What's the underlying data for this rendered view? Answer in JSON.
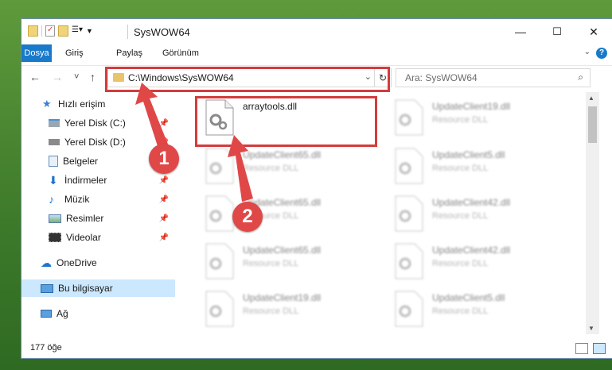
{
  "window": {
    "title": "SysWOW64",
    "controls": {
      "minimize": "—",
      "maximize": "☐",
      "close": "✕"
    }
  },
  "ribbon": {
    "tabs": [
      "Dosya",
      "Giriş",
      "Paylaş",
      "Görünüm"
    ],
    "help": "?"
  },
  "nav": {
    "back": "←",
    "forward": "→",
    "recent": "˅",
    "up": "↑",
    "address": "C:\\Windows\\SysWOW64",
    "search_placeholder": "Ara: SysWOW64"
  },
  "sidebar": {
    "items": [
      {
        "label": "Hızlı erişim",
        "icon": "star-icon",
        "pinned": false
      },
      {
        "label": "Yerel Disk (C:)",
        "icon": "drive-icon",
        "pinned": true
      },
      {
        "label": "Yerel Disk (D:)",
        "icon": "drive-icon",
        "pinned": true
      },
      {
        "label": "Belgeler",
        "icon": "document-icon",
        "pinned": true
      },
      {
        "label": "İndirmeler",
        "icon": "download-icon",
        "pinned": true
      },
      {
        "label": "Müzik",
        "icon": "music-icon",
        "pinned": true
      },
      {
        "label": "Resimler",
        "icon": "picture-icon",
        "pinned": true
      },
      {
        "label": "Videolar",
        "icon": "video-icon",
        "pinned": true
      },
      {
        "label": "OneDrive",
        "icon": "cloud-icon",
        "pinned": false
      },
      {
        "label": "Bu bilgisayar",
        "icon": "computer-icon",
        "pinned": false
      },
      {
        "label": "Ağ",
        "icon": "network-icon",
        "pinned": false
      }
    ]
  },
  "files": [
    {
      "name": "arraytools.dll",
      "type": ""
    },
    {
      "name": "UpdateClient19.dll",
      "type": "Resource DLL"
    },
    {
      "name": "UpdateClient65.dll",
      "type": "Resource DLL"
    },
    {
      "name": "UpdateClient5.dll",
      "type": "Resource DLL"
    },
    {
      "name": "UpdateClient65.dll",
      "type": "Resource DLL"
    },
    {
      "name": "UpdateClient42.dll",
      "type": "Resource DLL"
    },
    {
      "name": "UpdateClient65.dll",
      "type": "Resource DLL"
    },
    {
      "name": "UpdateClient42.dll",
      "type": "Resource DLL"
    },
    {
      "name": "UpdateClient19.dll",
      "type": "Resource DLL"
    },
    {
      "name": "UpdateClient5.dll",
      "type": "Resource DLL"
    }
  ],
  "status": {
    "count": "177 öğe"
  },
  "annotations": {
    "badge1": "1",
    "badge2": "2",
    "color": "#d33c3c"
  }
}
